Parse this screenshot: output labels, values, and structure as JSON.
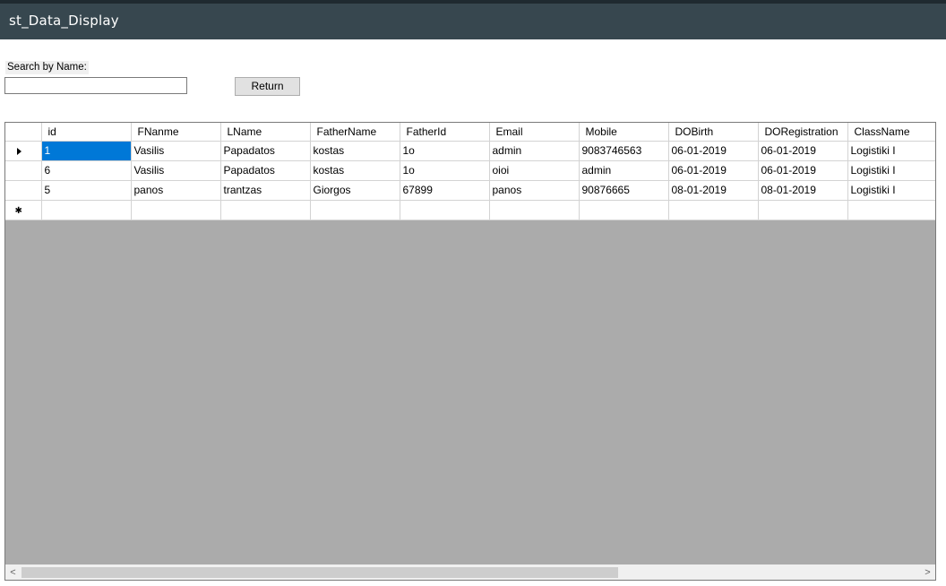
{
  "window": {
    "title": "st_Data_Display"
  },
  "search": {
    "label": "Search by Name:",
    "value": "",
    "placeholder": ""
  },
  "buttons": {
    "return_label": "Return"
  },
  "grid": {
    "columns": [
      "id",
      "FNanme",
      "LName",
      "FatherName",
      "FatherId",
      "Email",
      "Mobile",
      "DOBirth",
      "DORegistration",
      "ClassName"
    ],
    "rows": [
      [
        "1",
        "Vasilis",
        "Papadatos",
        "kostas",
        "1o",
        "admin",
        "9083746563",
        "06-01-2019",
        "06-01-2019",
        "Logistiki I"
      ],
      [
        "6",
        "Vasilis",
        "Papadatos",
        "kostas",
        "1o",
        "oioi",
        "admin",
        "06-01-2019",
        "06-01-2019",
        "Logistiki I"
      ],
      [
        "5",
        "panos",
        "trantzas",
        "Giorgos",
        "67899",
        "panos",
        "90876665",
        "08-01-2019",
        "08-01-2019",
        "Logistiki I"
      ]
    ],
    "current_row_marker": "▶",
    "new_row_marker": "✱"
  },
  "scrollbar": {
    "left_arrow": "<",
    "right_arrow": ">"
  },
  "colors": {
    "titlebar": "#37474f",
    "selection": "#0078d7",
    "grid_empty": "#ababab"
  }
}
